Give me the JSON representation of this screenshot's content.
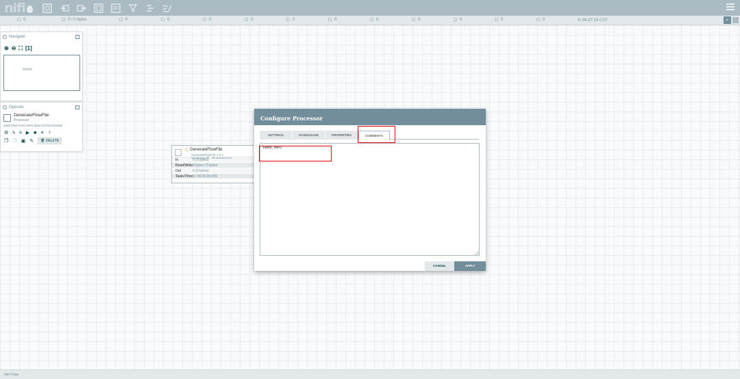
{
  "app": {
    "logo_text": "nifi"
  },
  "toolbar": {
    "icons": [
      "processor-icon",
      "input-port-icon",
      "output-port-icon",
      "process-group-icon",
      "remote-process-group-icon",
      "funnel-icon",
      "template-icon",
      "label-icon"
    ]
  },
  "status": {
    "items": [
      {
        "value": "0",
        "name": "transmitting-icon"
      },
      {
        "value": "0 / 0 bytes",
        "name": "queued-icon"
      },
      {
        "value": "0",
        "name": "running-icon"
      },
      {
        "value": "0",
        "name": "stopped-icon"
      },
      {
        "value": "0",
        "name": "invalid-icon"
      },
      {
        "value": "0",
        "name": "disabled-icon"
      },
      {
        "value": "0",
        "name": "warning-icon"
      },
      {
        "value": "0",
        "name": "locally-modified-icon"
      },
      {
        "value": "0",
        "name": "up-to-date-icon"
      },
      {
        "value": "0",
        "name": "stale-icon"
      },
      {
        "value": "0",
        "name": "sync-failure-icon"
      },
      {
        "value": "0",
        "name": "not-transmitting-icon"
      },
      {
        "value": "0",
        "name": "remote-icon"
      }
    ],
    "clock": "09:47:15 CST"
  },
  "navigate": {
    "title": "Navigate"
  },
  "operate": {
    "title": "Operate",
    "component_name": "GenerateFlowFile",
    "component_type": "Processor",
    "component_id": "3da6768d-0193-1000-ab6a-467b578d4069",
    "delete_label": "DELETE"
  },
  "processor": {
    "name": "GenerateFlowFile",
    "type": "GenerateFlowFile 1.9.2",
    "bundle": "org.apache.nifi - nifi-standard-nar",
    "stats": [
      {
        "label": "In",
        "value": "0 (0 bytes)"
      },
      {
        "label": "Read/Write",
        "value": "0 bytes / 0 bytes"
      },
      {
        "label": "Out",
        "value": "0 (0 bytes)"
      },
      {
        "label": "Tasks/Time",
        "value": "0 / 00:00:00.000"
      }
    ]
  },
  "dialog": {
    "title": "Configure Processor",
    "tabs": [
      "SETTINGS",
      "SCHEDULING",
      "PROPERTIES",
      "COMMENTS"
    ],
    "selected_tab": "COMMENTS",
    "comments_value": "Hello, NiFi|",
    "cancel_label": "CANCEL",
    "apply_label": "APPLY"
  },
  "footer": {
    "text": "NiFi Flow"
  },
  "colors": {
    "toolbar": "#aabbc3",
    "dialog_header": "#728e9b",
    "highlight": "#e10000"
  }
}
